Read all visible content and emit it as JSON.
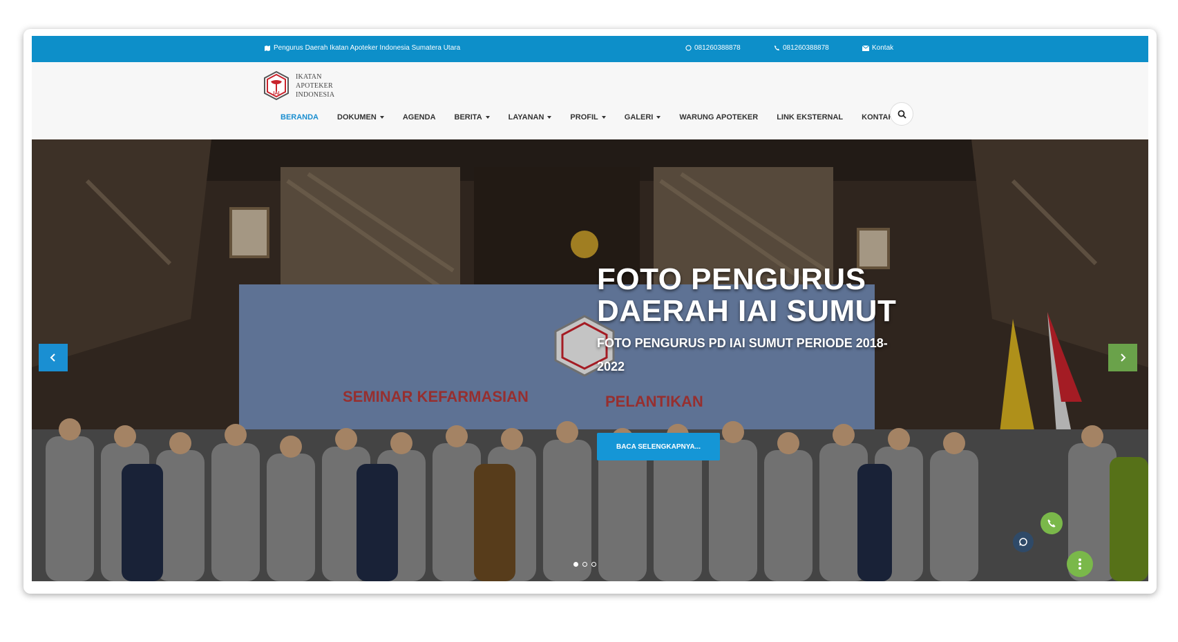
{
  "topbar": {
    "org_name": "Pengurus Daerah Ikatan Apoteker Indonesia Sumatera Utara",
    "whatsapp": "081260388878",
    "phone": "081260388878",
    "contact": "Kontak",
    "icons": [
      "map-icon",
      "whatsapp-icon",
      "phone-icon",
      "envelope-icon"
    ]
  },
  "logo": {
    "badge": "IAI",
    "line1": "IKATAN",
    "line2": "APOTEKER",
    "line3": "INDONESIA"
  },
  "nav": {
    "items": [
      {
        "label": "BERANDA",
        "dropdown": false,
        "active": true
      },
      {
        "label": "DOKUMEN",
        "dropdown": true,
        "active": false
      },
      {
        "label": "AGENDA",
        "dropdown": false,
        "active": false
      },
      {
        "label": "BERITA",
        "dropdown": true,
        "active": false
      },
      {
        "label": "LAYANAN",
        "dropdown": true,
        "active": false
      },
      {
        "label": "PROFIL",
        "dropdown": true,
        "active": false
      },
      {
        "label": "GALERI",
        "dropdown": true,
        "active": false
      },
      {
        "label": "WARUNG APOTEKER",
        "dropdown": false,
        "active": false
      },
      {
        "label": "LINK EKSTERNAL",
        "dropdown": false,
        "active": false
      },
      {
        "label": "KONTAK",
        "dropdown": false,
        "active": false
      }
    ],
    "search_icon": "search-icon"
  },
  "hero": {
    "title": "FOTO PENGURUS DAERAH IAI SUMUT",
    "subtitle": "FOTO PENGURUS PD IAI SUMUT PERIODE 2018-2022",
    "button": "BACA SELENGKAPNYA...",
    "banner_text_1": "SEMINAR KEFARMASIAN",
    "banner_text_2": "PELANTIKAN",
    "slides_count": 3,
    "active_slide": 1
  },
  "colors": {
    "brand_blue": "#0d8fc9",
    "nav_active": "#1a8ed0",
    "next_arrow": "#6aa24a",
    "fab_green": "#7ab84a",
    "whatsapp_dark": "#2f4a68"
  }
}
